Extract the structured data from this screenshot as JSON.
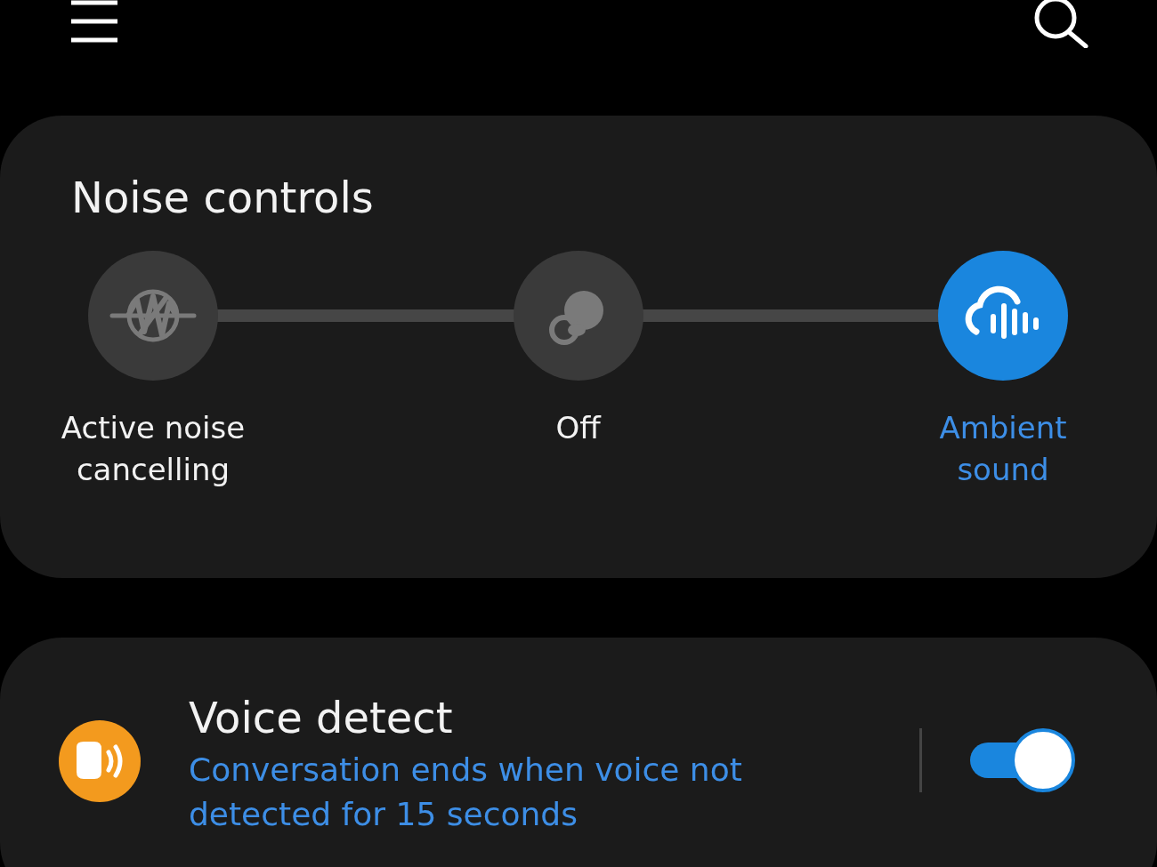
{
  "noise_controls": {
    "title": "Noise controls",
    "options": [
      {
        "kind": "anc",
        "label": "Active noise cancelling",
        "selected": false
      },
      {
        "kind": "off",
        "label": "Off",
        "selected": false
      },
      {
        "kind": "ambient",
        "label": "Ambient sound",
        "selected": true
      }
    ]
  },
  "voice_detect": {
    "title": "Voice detect",
    "description": "Conversation ends when voice not detected for 15 seconds",
    "on": true
  }
}
